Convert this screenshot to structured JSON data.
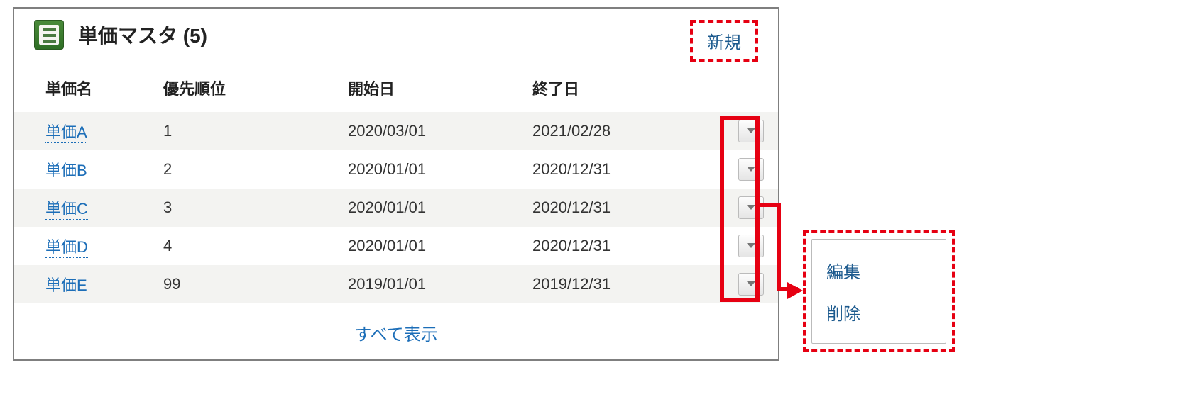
{
  "panel": {
    "title": "単価マスタ (5)",
    "new_button": "新規",
    "show_all": "すべて表示"
  },
  "columns": {
    "name": "単価名",
    "priority": "優先順位",
    "start": "開始日",
    "end": "終了日"
  },
  "rows": [
    {
      "name": "単価A",
      "priority": "1",
      "start": "2020/03/01",
      "end": "2021/02/28"
    },
    {
      "name": "単価B",
      "priority": "2",
      "start": "2020/01/01",
      "end": "2020/12/31"
    },
    {
      "name": "単価C",
      "priority": "3",
      "start": "2020/01/01",
      "end": "2020/12/31"
    },
    {
      "name": "単価D",
      "priority": "4",
      "start": "2020/01/01",
      "end": "2020/12/31"
    },
    {
      "name": "単価E",
      "priority": "99",
      "start": "2019/01/01",
      "end": "2019/12/31"
    }
  ],
  "popup": {
    "edit": "編集",
    "delete": "削除"
  }
}
